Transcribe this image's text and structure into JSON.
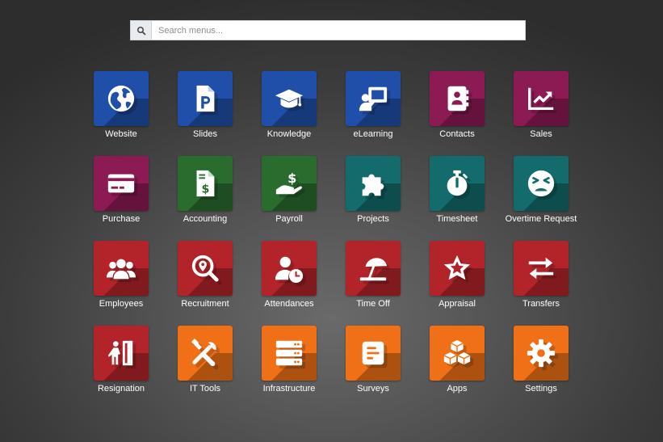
{
  "search": {
    "placeholder": "Search menus...",
    "icon": "search-icon"
  },
  "apps": [
    {
      "label": "Website",
      "icon": "globe-icon",
      "color": "#1f4fa8"
    },
    {
      "label": "Slides",
      "icon": "slides-file-icon",
      "color": "#1f4fa8"
    },
    {
      "label": "Knowledge",
      "icon": "graduation-cap-icon",
      "color": "#1f4fa8"
    },
    {
      "label": "eLearning",
      "icon": "teacher-board-icon",
      "color": "#1f4fa8"
    },
    {
      "label": "Contacts",
      "icon": "address-book-icon",
      "color": "#8c1a53"
    },
    {
      "label": "Sales",
      "icon": "line-chart-icon",
      "color": "#8c1a53"
    },
    {
      "label": "Purchase",
      "icon": "credit-card-icon",
      "color": "#8c1a53"
    },
    {
      "label": "Accounting",
      "icon": "invoice-dollar-icon",
      "color": "#2a6b2e"
    },
    {
      "label": "Payroll",
      "icon": "hand-dollar-icon",
      "color": "#2a6b2e"
    },
    {
      "label": "Projects",
      "icon": "puzzle-piece-icon",
      "color": "#136b6b"
    },
    {
      "label": "Timesheet",
      "icon": "stopwatch-icon",
      "color": "#136b6b"
    },
    {
      "label": "Overtime Request",
      "icon": "tired-face-icon",
      "color": "#136b6b"
    },
    {
      "label": "Employees",
      "icon": "users-icon",
      "color": "#b3242a"
    },
    {
      "label": "Recruitment",
      "icon": "search-location-icon",
      "color": "#b3242a"
    },
    {
      "label": "Attendances",
      "icon": "user-clock-icon",
      "color": "#b3242a"
    },
    {
      "label": "Time Off",
      "icon": "umbrella-beach-icon",
      "color": "#b3242a"
    },
    {
      "label": "Appraisal",
      "icon": "star-icon",
      "color": "#b3242a"
    },
    {
      "label": "Transfers",
      "icon": "exchange-arrows-icon",
      "color": "#b3242a"
    },
    {
      "label": "Resignation",
      "icon": "exit-door-icon",
      "color": "#b3242a"
    },
    {
      "label": "IT Tools",
      "icon": "tools-icon",
      "color": "#ef7016"
    },
    {
      "label": "Infrastructure",
      "icon": "server-icon",
      "color": "#ef7016"
    },
    {
      "label": "Surveys",
      "icon": "survey-list-icon",
      "color": "#ef7016"
    },
    {
      "label": "Apps",
      "icon": "cubes-icon",
      "color": "#ef7016"
    },
    {
      "label": "Settings",
      "icon": "gear-icon",
      "color": "#ef7016"
    }
  ]
}
